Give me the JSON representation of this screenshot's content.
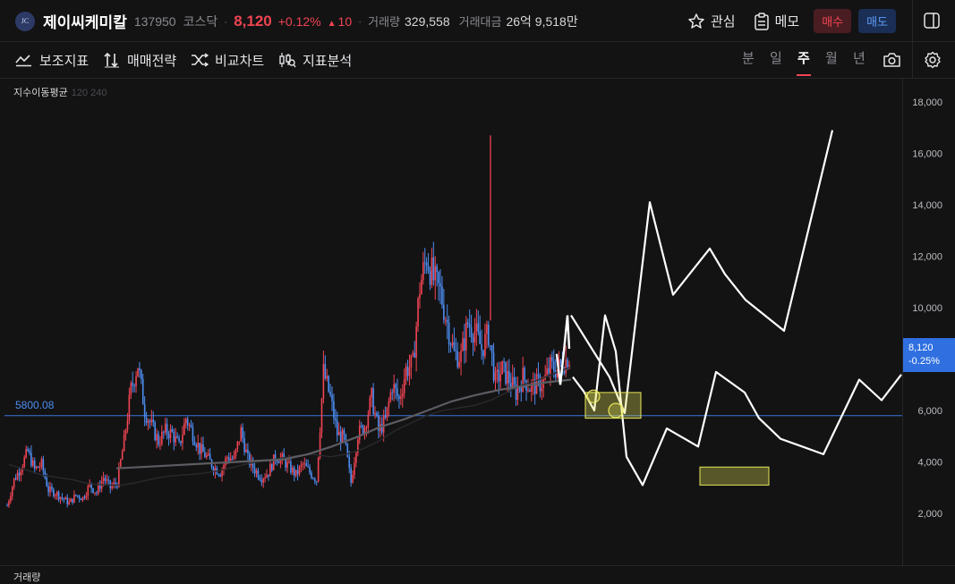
{
  "header": {
    "logo_text": "JC",
    "name": "제이씨케미칼",
    "code": "137950",
    "market": "코스닥",
    "price": "8,120",
    "change_pct": "+0.12%",
    "change_arrow": "▲",
    "change_abs": "10",
    "volume_label": "거래량",
    "volume": "329,558",
    "amount_label": "거래대금",
    "amount": "26억 9,518만",
    "watch_label": "관심",
    "memo_label": "메모",
    "buy_label": "매수",
    "sell_label": "매도",
    "icons": [
      "star-icon",
      "memo-icon",
      "panel-toggle-icon"
    ]
  },
  "toolbar": {
    "tools": [
      "보조지표",
      "매매전략",
      "비교차트",
      "지표분석"
    ],
    "periods": [
      "분",
      "일",
      "주",
      "월",
      "년"
    ],
    "active_period": "주",
    "icons": [
      "indicator-icon",
      "strategy-icon",
      "compare-icon",
      "analysis-icon",
      "camera-icon",
      "settings-icon"
    ]
  },
  "indicator": {
    "title": "지수이동평균",
    "params": "120 240"
  },
  "volume_label": "거래량",
  "colors": {
    "up": "#f04452",
    "down": "#4d8df0",
    "accent": "#2f6fe0",
    "hline": "#3a74d8",
    "box": "#e8e85a"
  },
  "chart_data": {
    "type": "line",
    "title": "",
    "xlabel": "",
    "ylabel": "",
    "ylim": [
      0,
      19000
    ],
    "yticks": [
      2000,
      4000,
      6000,
      8000,
      10000,
      12000,
      14000,
      16000,
      18000
    ],
    "ytick_labels": [
      "2,000",
      "4,000",
      "6,000",
      "8,000",
      "10,000",
      "12,000",
      "14,000",
      "16,000",
      "18,000"
    ],
    "grid": false,
    "horizontal_line": {
      "value": 5800.08,
      "label": "5800.08"
    },
    "last_price": {
      "value": 8120,
      "label": "8,120",
      "change": "-0.25%"
    },
    "series": [
      {
        "values": [
          2300,
          3300,
          3800,
          4400,
          3700,
          3900,
          2900,
          2800,
          2600,
          2400,
          2700,
          2600,
          3100,
          2800,
          3400,
          3000,
          3200,
          4800,
          6800,
          7800,
          6000,
          5400,
          4800,
          5200,
          5100,
          4600,
          5700,
          5100,
          4500,
          4200,
          3800,
          3600,
          4200,
          4100,
          5200,
          4100,
          3700,
          3400,
          3600,
          4200,
          4100,
          3800,
          3500,
          3900,
          3600,
          3300,
          7500,
          6500,
          5100,
          4900,
          3200,
          5100,
          5400,
          6500,
          5200,
          5600,
          7000,
          6400,
          7600,
          7800,
          10800,
          12000,
          11100,
          10600,
          9400,
          8200,
          8100,
          9400,
          9100,
          8400,
          9000,
          7100,
          7600,
          7200,
          6700,
          7300,
          6900,
          7000,
          7100,
          7700,
          7600,
          7900,
          8120
        ]
      },
      {
        "values": [
          3900,
          3700,
          3500,
          3400,
          3300,
          3150,
          3100,
          3100,
          3200,
          3350,
          3450,
          3500,
          3550,
          3650,
          3800,
          3950,
          4050,
          4150,
          4250,
          4300,
          4200,
          4300,
          4500,
          4800,
          5200,
          5500,
          5800,
          6000,
          6100,
          6200,
          6400,
          6700,
          7000,
          7200,
          7450,
          7700
        ]
      },
      {
        "values": [
          3750,
          3800,
          3850,
          3900,
          3950,
          4000,
          4050,
          4100,
          4300,
          4600,
          4950,
          5350,
          5650,
          6000,
          6350,
          6600,
          6800,
          6950,
          7100,
          7200
        ]
      },
      {
        "values": [
          7300,
          6750,
          6000,
          9700,
          8300,
          4200,
          3100,
          5300,
          4600,
          7500,
          6700,
          5700,
          4900,
          4300,
          7200,
          6400,
          7400
        ]
      },
      {
        "values": [
          9700,
          7300,
          5900,
          14100,
          10500,
          12300,
          11300,
          10300,
          9100,
          16900
        ]
      }
    ],
    "annotations": [
      {
        "type": "box",
        "x": [
          "2023-09",
          "2023-11"
        ],
        "y": [
          5700,
          6700
        ]
      },
      {
        "type": "box",
        "x": [
          "2025-04",
          "2025-06"
        ],
        "y": [
          3100,
          3800
        ]
      },
      {
        "type": "circle",
        "y": 6550
      },
      {
        "type": "circle",
        "y": 6000
      }
    ]
  }
}
